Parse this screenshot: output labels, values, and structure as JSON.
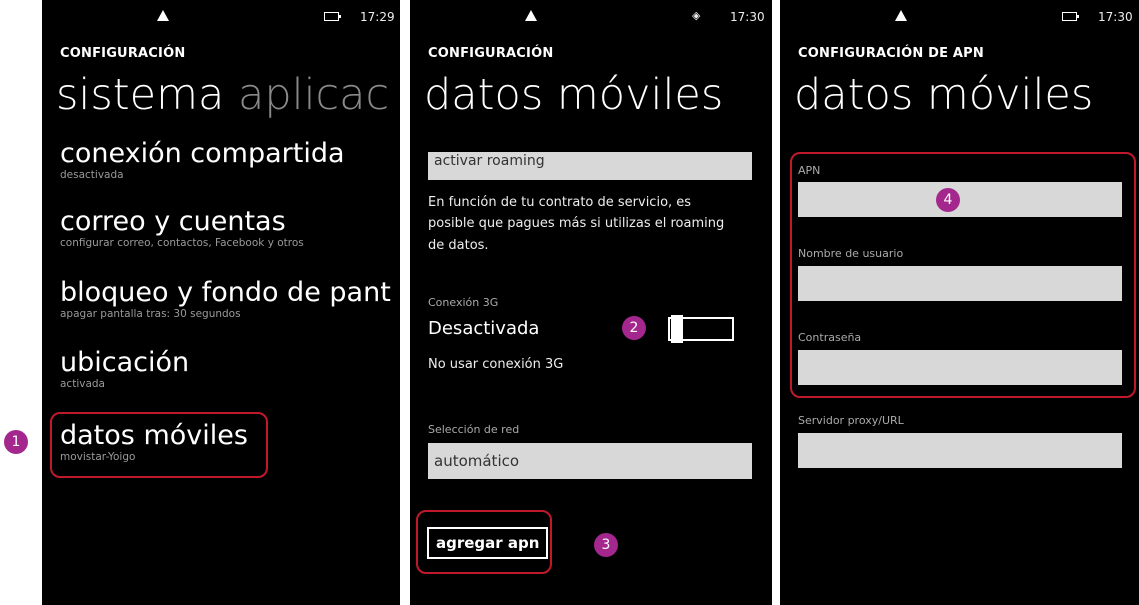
{
  "accent_highlight": "#c0192b",
  "badge_color": "#a3278c",
  "screen1": {
    "status_time": "17:29",
    "header": "CONFIGURACIÓN",
    "pivot_active": "sistema",
    "pivot_next": "aplicac",
    "items": [
      {
        "title": "conexión compartida",
        "subtitle": "desactivada"
      },
      {
        "title": "correo y cuentas",
        "subtitle": "configurar correo, contactos, Facebook y otros"
      },
      {
        "title": "bloqueo y fondo de pant",
        "subtitle": "apagar pantalla tras: 30 segundos"
      },
      {
        "title": "ubicación",
        "subtitle": "activada"
      },
      {
        "title": "datos móviles",
        "subtitle": "movistar-Yoigo"
      }
    ],
    "step": "1"
  },
  "screen2": {
    "status_time": "17:30",
    "header": "CONFIGURACIÓN",
    "title": "datos móviles",
    "roaming_field": "activar roaming",
    "roaming_info": "En función de tu contrato de servicio, es posible que pagues más si utilizas el roaming de datos.",
    "conn3g_label": "Conexión 3G",
    "conn3g_state": "Desactivada",
    "conn3g_desc": "No usar conexión 3G",
    "network_label": "Selección de red",
    "network_value": "automático",
    "add_apn": "agregar apn",
    "step_toggle": "2",
    "step_apn": "3"
  },
  "screen3": {
    "status_time": "17:30",
    "header": "CONFIGURACIÓN DE APN",
    "title": "datos móviles",
    "apn_label": "APN",
    "user_label": "Nombre de usuario",
    "password_label": "Contraseña",
    "proxy_label": "Servidor proxy/URL",
    "step": "4"
  }
}
